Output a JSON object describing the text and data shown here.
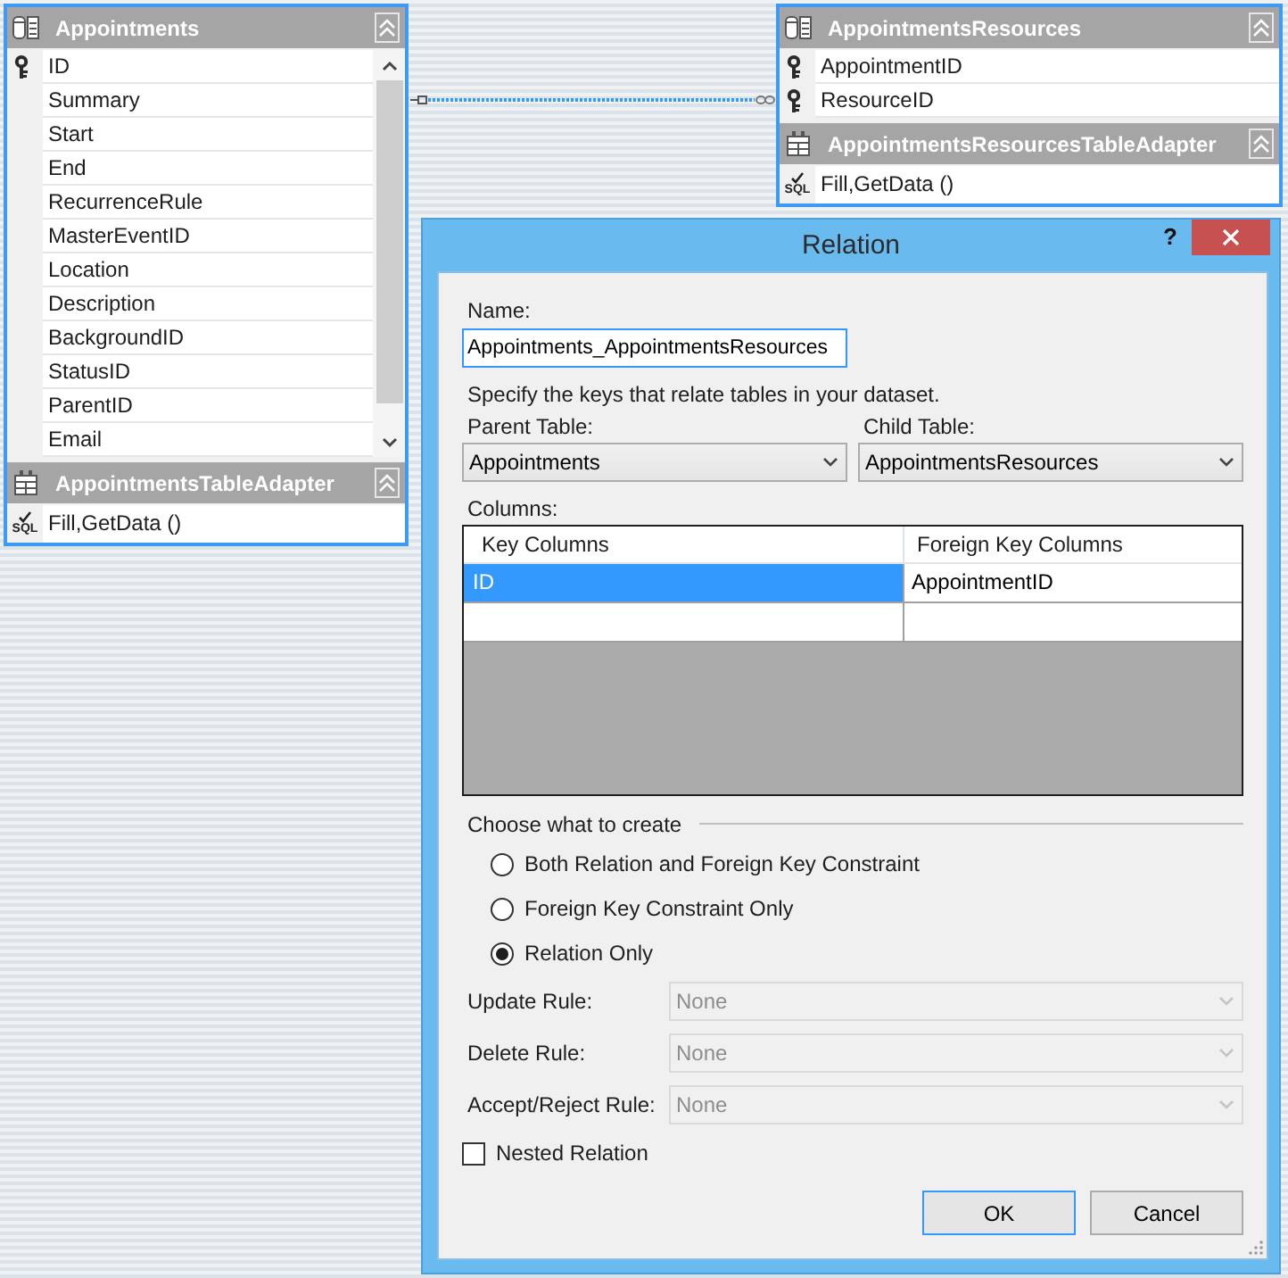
{
  "canvas": {
    "tables": [
      {
        "title": "Appointments",
        "columns": [
          {
            "name": "ID",
            "key": true
          },
          {
            "name": "Summary",
            "key": false
          },
          {
            "name": "Start",
            "key": false
          },
          {
            "name": "End",
            "key": false
          },
          {
            "name": "RecurrenceRule",
            "key": false
          },
          {
            "name": "MasterEventID",
            "key": false
          },
          {
            "name": "Location",
            "key": false
          },
          {
            "name": "Description",
            "key": false
          },
          {
            "name": "BackgroundID",
            "key": false
          },
          {
            "name": "StatusID",
            "key": false
          },
          {
            "name": "ParentID",
            "key": false
          },
          {
            "name": "Email",
            "key": false
          }
        ],
        "scrollable": true,
        "adapter": {
          "title": "AppointmentsTableAdapter",
          "queries": [
            {
              "badge": "SQL",
              "text": "Fill,GetData ()"
            }
          ]
        }
      },
      {
        "title": "AppointmentsResources",
        "columns": [
          {
            "name": "AppointmentID",
            "key": true
          },
          {
            "name": "ResourceID",
            "key": true
          }
        ],
        "scrollable": false,
        "adapter": {
          "title": "AppointmentsResourcesTableAdapter",
          "queries": [
            {
              "badge": "SQL",
              "text": "Fill,GetData ()"
            }
          ]
        }
      }
    ]
  },
  "dialog": {
    "title": "Relation",
    "help": "?",
    "name": {
      "label": "Name:",
      "value": "Appointments_AppointmentsResources",
      "focused": true
    },
    "instructions": "Specify the keys that relate tables in your dataset.",
    "tables": [
      {
        "label": "Parent Table:",
        "value": "Appointments"
      },
      {
        "label": "Child Table:",
        "value": "AppointmentsResources"
      }
    ],
    "columns": {
      "label": "Columns:",
      "headers": [
        "Key Columns",
        "Foreign Key Columns"
      ],
      "rows": [
        {
          "cells": [
            {
              "text": "ID",
              "selected": true
            },
            {
              "text": "AppointmentID",
              "selected": false
            }
          ]
        }
      ]
    },
    "create": {
      "label": "Choose what to create",
      "options": [
        {
          "label": "Both Relation and Foreign Key Constraint",
          "selected": false
        },
        {
          "label": "Foreign Key Constraint Only",
          "selected": false
        },
        {
          "label": "Relation Only",
          "selected": true
        }
      ]
    },
    "rules": [
      {
        "label": "Update Rule:",
        "value": "None",
        "disabled": true
      },
      {
        "label": "Delete Rule:",
        "value": "None",
        "disabled": true
      },
      {
        "label": "Accept/Reject Rule:",
        "value": "None",
        "disabled": true
      }
    ],
    "nested_relation": {
      "label": "Nested Relation",
      "checked": false
    },
    "buttons": [
      {
        "label": "OK",
        "default": true
      },
      {
        "label": "Cancel",
        "default": false
      }
    ]
  }
}
